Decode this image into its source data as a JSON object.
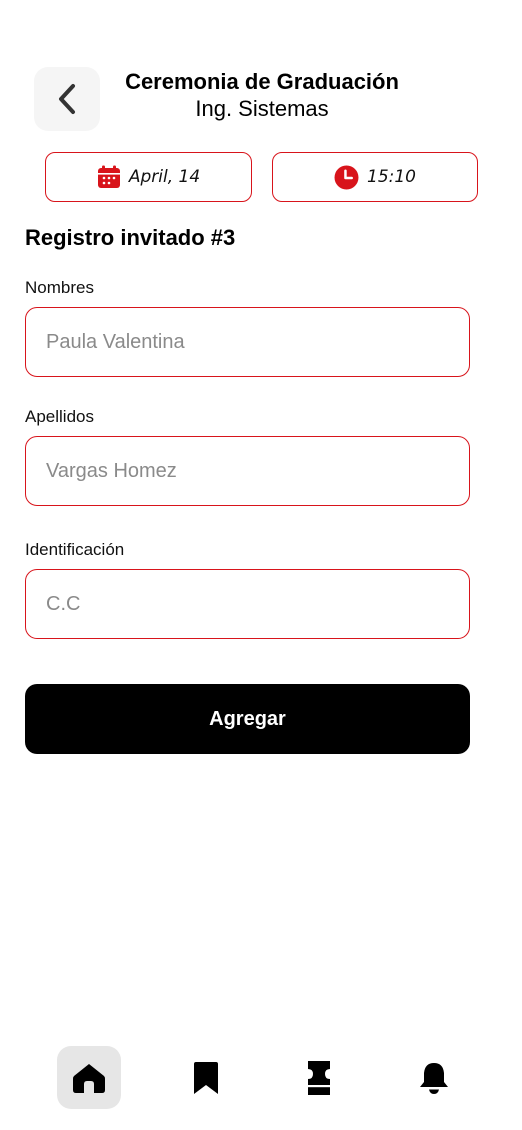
{
  "header": {
    "title": "Ceremonia de Graduación",
    "subtitle": "Ing. Sistemas",
    "back_icon": "chevron-left-icon"
  },
  "event": {
    "date": "April, 14",
    "time": "15:10",
    "date_icon": "calendar-icon",
    "time_icon": "clock-icon"
  },
  "form": {
    "title": "Registro invitado #3",
    "fields": [
      {
        "label": "Nombres",
        "placeholder": "Paula Valentina",
        "value": ""
      },
      {
        "label": "Apellidos",
        "placeholder": "Vargas Homez",
        "value": ""
      },
      {
        "label": "Identificación",
        "placeholder": "C.C",
        "value": ""
      }
    ],
    "submit_label": "Agregar"
  },
  "bottom_nav": {
    "items": [
      {
        "icon": "home-icon",
        "active": true
      },
      {
        "icon": "bookmark-icon",
        "active": false
      },
      {
        "icon": "ticket-icon",
        "active": false
      },
      {
        "icon": "bell-icon",
        "active": false
      }
    ]
  },
  "colors": {
    "accent": "#d8141b",
    "primary_button": "#000000",
    "back_button_bg": "#f5f5f5",
    "nav_active_bg": "#e6e6e6"
  }
}
